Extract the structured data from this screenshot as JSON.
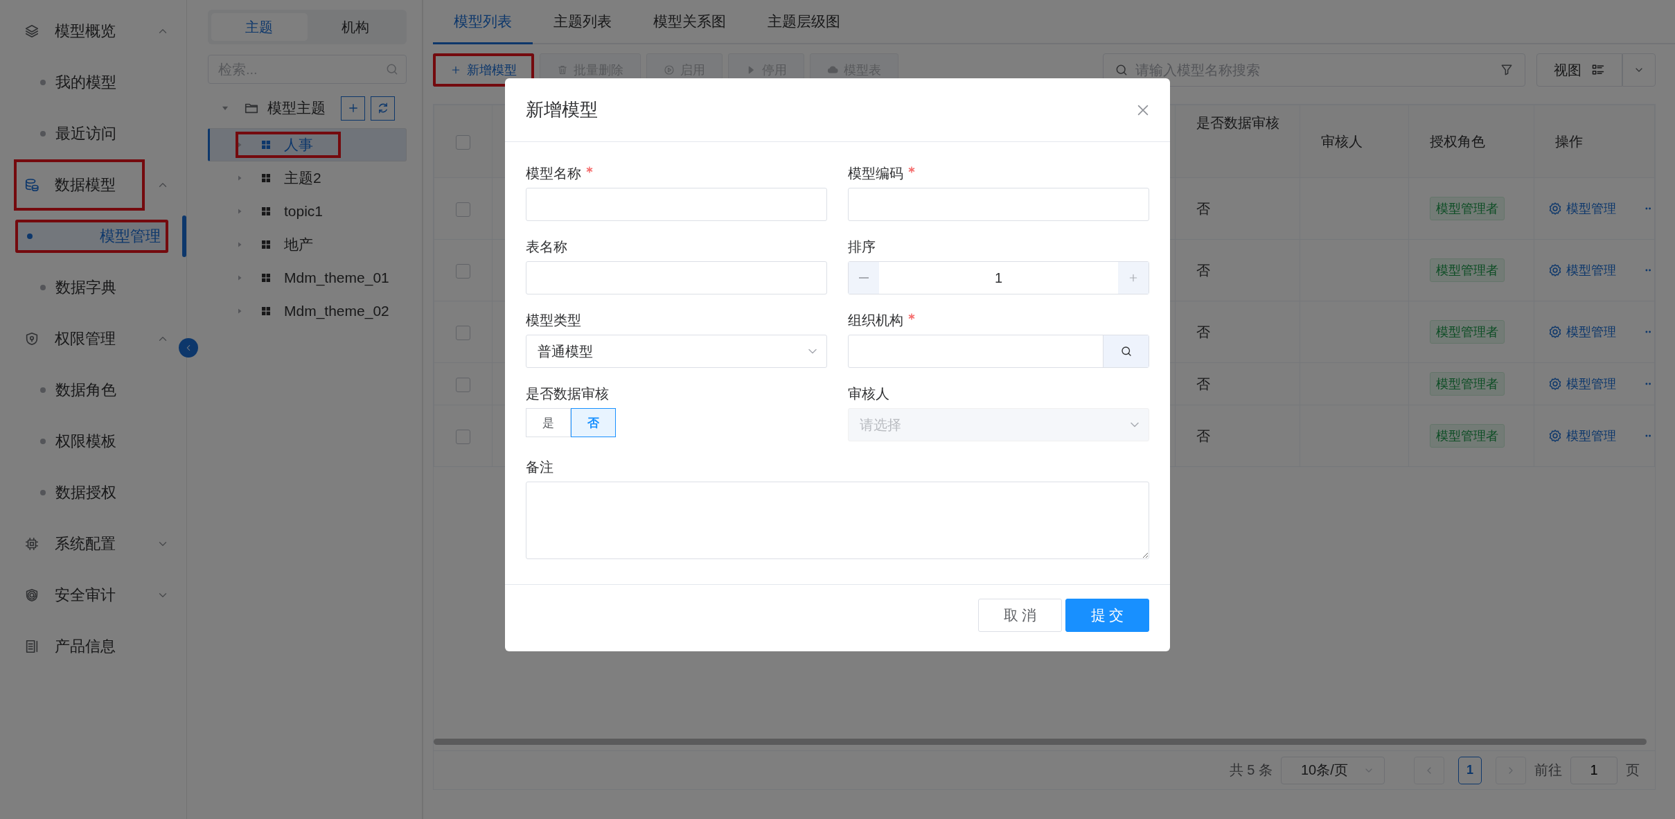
{
  "sidebar": {
    "items": [
      {
        "kind": "group",
        "label": "模型概览",
        "expanded": true,
        "active": false,
        "annotated": false,
        "children": [
          {
            "label": "我的模型",
            "selected": false,
            "annotated": false
          },
          {
            "label": "最近访问",
            "selected": false,
            "annotated": false
          }
        ]
      },
      {
        "kind": "group",
        "label": "数据模型",
        "expanded": true,
        "active": true,
        "annotated": true,
        "children": [
          {
            "label": "模型管理",
            "selected": true,
            "annotated": true
          },
          {
            "label": "数据字典",
            "selected": false,
            "annotated": false
          }
        ]
      },
      {
        "kind": "group",
        "label": "权限管理",
        "expanded": true,
        "active": false,
        "annotated": false,
        "children": [
          {
            "label": "数据角色",
            "selected": false,
            "annotated": false
          },
          {
            "label": "权限模板",
            "selected": false,
            "annotated": false
          },
          {
            "label": "数据授权",
            "selected": false,
            "annotated": false
          }
        ]
      },
      {
        "kind": "group",
        "label": "系统配置",
        "expanded": false,
        "active": false,
        "annotated": false
      },
      {
        "kind": "group",
        "label": "安全审计",
        "expanded": false,
        "active": false,
        "annotated": false
      },
      {
        "kind": "link",
        "label": "产品信息",
        "active": false,
        "annotated": false
      }
    ]
  },
  "tree_panel": {
    "tabs": [
      {
        "label": "主题",
        "selected": true
      },
      {
        "label": "机构",
        "selected": false
      }
    ],
    "search": {
      "placeholder": "检索..."
    },
    "tree": {
      "label": "模型主题",
      "expanded": true,
      "children": [
        {
          "label": "人事",
          "expanded": false,
          "selected": true,
          "annotated": true
        },
        {
          "label": "主题2",
          "expanded": false,
          "selected": false,
          "annotated": false
        },
        {
          "label": "topic1",
          "expanded": false,
          "selected": false,
          "annotated": false
        },
        {
          "label": "地产",
          "expanded": false,
          "selected": false,
          "annotated": false
        },
        {
          "label": "Mdm_theme_01",
          "expanded": false,
          "selected": false,
          "annotated": false
        },
        {
          "label": "Mdm_theme_02",
          "expanded": false,
          "selected": false,
          "annotated": false
        }
      ]
    }
  },
  "tabs": [
    {
      "label": "模型列表",
      "selected": true
    },
    {
      "label": "主题列表",
      "selected": false
    },
    {
      "label": "模型关系图",
      "selected": false
    },
    {
      "label": "主题层级图",
      "selected": false
    }
  ],
  "toolbar": {
    "buttons": [
      {
        "label": "新增模型",
        "disabled": false,
        "annotated": true
      },
      {
        "label": "批量删除",
        "disabled": true,
        "annotated": false
      },
      {
        "label": "启用",
        "disabled": true,
        "annotated": false
      },
      {
        "label": "停用",
        "disabled": true,
        "annotated": false
      },
      {
        "label": "模型表",
        "disabled": true,
        "annotated": false
      }
    ],
    "search": {
      "placeholder": "请输入模型名称搜索"
    },
    "view_button": {
      "label": "视图"
    }
  },
  "table": {
    "all_checked": false,
    "columns": [
      "是否数据审核",
      "审核人",
      "授权角色",
      "操作"
    ],
    "rows": [
      {
        "checked": false,
        "data_audit": "否",
        "role": "模型管理者",
        "action": "模型管理"
      },
      {
        "checked": false,
        "data_audit": "否",
        "role": "模型管理者",
        "action": "模型管理"
      },
      {
        "checked": false,
        "data_audit": "否",
        "role": "模型管理者",
        "action": "模型管理"
      },
      {
        "checked": false,
        "data_audit": "否",
        "role": "模型管理者",
        "action": "模型管理"
      },
      {
        "checked": false,
        "data_audit": "否",
        "role": "模型管理者",
        "action": "模型管理"
      }
    ]
  },
  "pagination": {
    "total": "共 5 条",
    "page_size": "10条/页",
    "pages": [
      {
        "label": "1",
        "selected": true
      }
    ],
    "goto_label": "前往",
    "goto_value": "1",
    "goto_unit": "页"
  },
  "dialog": {
    "title": "新增模型",
    "fields": [
      {
        "kind": "text",
        "label": "模型名称",
        "required": true
      },
      {
        "kind": "text",
        "label": "模型编码",
        "required": true
      },
      {
        "kind": "text",
        "label": "表名称",
        "required": false
      },
      {
        "kind": "number",
        "label": "排序",
        "required": false,
        "value": "1"
      },
      {
        "kind": "select",
        "label": "模型类型",
        "required": false,
        "value": "普通模型",
        "disabled": false
      },
      {
        "kind": "lookup",
        "label": "组织机构",
        "required": true
      },
      {
        "kind": "toggle",
        "label": "是否数据审核",
        "required": false,
        "options": [
          {
            "label": "是",
            "selected": false
          },
          {
            "label": "否",
            "selected": true
          }
        ]
      },
      {
        "kind": "select",
        "label": "审核人",
        "required": false,
        "placeholder": "请选择",
        "disabled": true
      },
      {
        "kind": "textarea",
        "label": "备注",
        "required": false
      }
    ],
    "buttons": [
      {
        "label": "取 消",
        "kind": "secondary"
      },
      {
        "label": "提 交",
        "kind": "primary"
      }
    ]
  }
}
